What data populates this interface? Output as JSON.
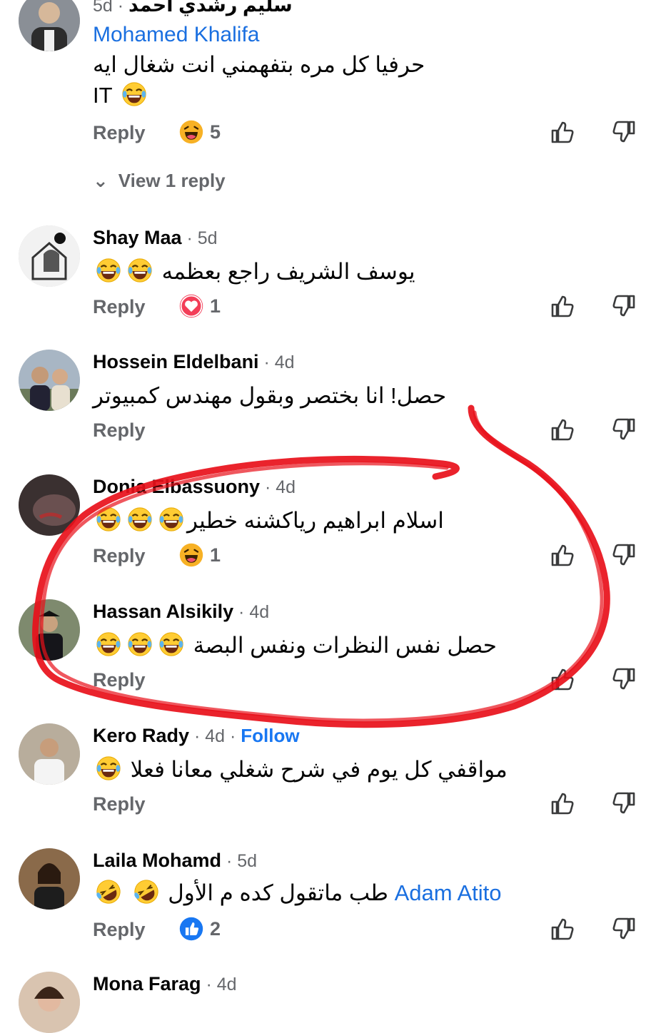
{
  "reply_label": "Reply",
  "view_replies": "View 1 reply",
  "top_partial": {
    "header_text": "سليم رشدي احمد",
    "time": "5d"
  },
  "comments": [
    {
      "author": "Mohamed Khalifa",
      "time": "",
      "text_line1": "حرفيا كل مره بتفهمني انت شغال ايه",
      "text_line2": "IT",
      "reaction": "haha",
      "reaction_count": "5"
    },
    {
      "author": "Shay Maa",
      "time": "5d",
      "text": "يوسف الشريف راجع بعظمه",
      "reaction": "love",
      "reaction_count": "1"
    },
    {
      "author": "Hossein Eldelbani",
      "time": "4d",
      "text": "حصل! انا بختصر وبقول مهندس كمبيوتر"
    },
    {
      "author": "Donia Elbassuony",
      "time": "4d",
      "text": "اسلام ابراهيم رياكشنه خطير",
      "reaction": "haha",
      "reaction_count": "1"
    },
    {
      "author": "Hassan Alsikily",
      "time": "4d",
      "text": "حصل نفس النظرات ونفس البصة"
    },
    {
      "author": "Kero Rady",
      "time": "4d",
      "follow": "Follow",
      "text": "مواقفي كل يوم في شرح شغلي معانا فعلا"
    },
    {
      "author": "Laila Mohamd",
      "time": "5d",
      "mention": "Adam Atito",
      "text": "طب ماتقول كده م الأول",
      "reaction": "like",
      "reaction_count": "2"
    },
    {
      "author": "Mona Farag",
      "time": "4d"
    }
  ],
  "colors": {
    "accent": "#1877f2",
    "muted": "#65676b",
    "annotation": "#e8101a"
  }
}
